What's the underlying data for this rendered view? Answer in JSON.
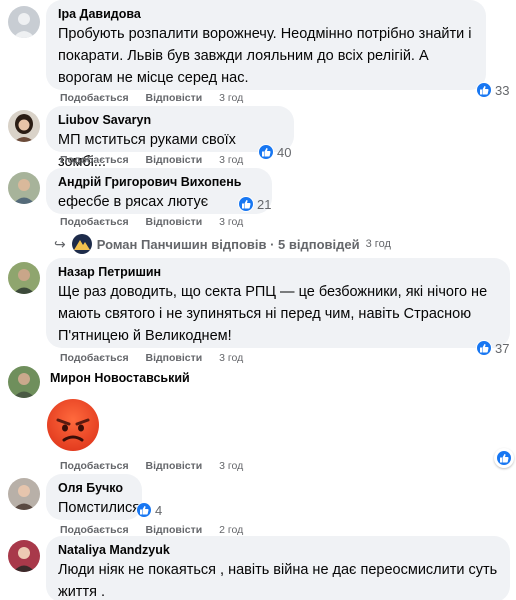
{
  "comments": [
    {
      "author": "Іра Давидова",
      "text": "Пробують розпалити ворожнечу. Неодмінно потрібно знайти і покарати. Львів був завжди лояльним до всіх релігій. А ворогам не місце серед нас.",
      "like": "Подобається",
      "reply": "Відповісти",
      "time": "3 год",
      "reactions": "33"
    },
    {
      "author": "Liubov Savaryn",
      "text": "МП мститься руками своїх зомбі...",
      "like": "Подобається",
      "reply": "Відповісти",
      "time": "3 год",
      "reactions": "40"
    },
    {
      "author": "Андрій Григорович Вихопень",
      "text": "ефесбе в рясах лютує",
      "like": "Подобається",
      "reply": "Відповісти",
      "time": "3 год",
      "reactions": "21",
      "replies_label": "Роман Панчишин відповів · 5 відповідей",
      "replies_time": "3 год"
    },
    {
      "author": "Назар Петришин",
      "text": "Ще раз доводить, що секта РПЦ — це безбожники, які нічого не мають святого і не зупиняться ні перед чим, навіть Страсною П'ятницею й Великоднем!",
      "like": "Подобається",
      "reply": "Відповісти",
      "time": "3 год",
      "reactions": "37"
    },
    {
      "author": "Мирон Новоставський",
      "sticker": "angry-face",
      "like": "Подобається",
      "reply": "Відповісти",
      "time": "3 год"
    },
    {
      "author": "Оля Бучко",
      "text": "Помстилися",
      "like": "Подобається",
      "reply": "Відповісти",
      "time": "2 год",
      "reactions": "4"
    },
    {
      "author": "Nataliya Mandzyuk",
      "text": "Люди ніяк не покаяться , навіть війна не дає переосмислити суть життя ."
    }
  ],
  "colors": {
    "bubble": "#f0f2f5",
    "like_blue": "#1877f2",
    "meta_gray": "#65676b"
  }
}
